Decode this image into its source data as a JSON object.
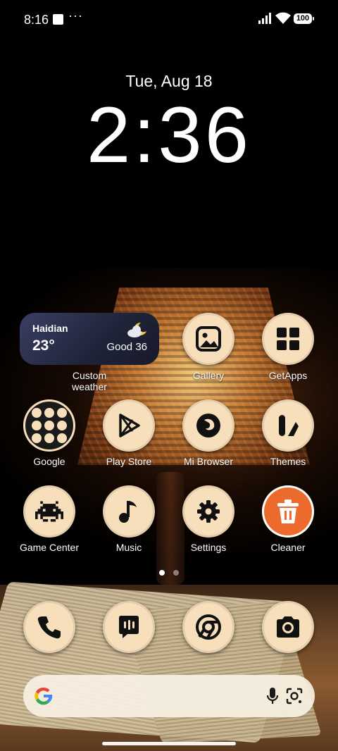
{
  "status_bar": {
    "time": "8:16",
    "overflow": "···",
    "battery": "100"
  },
  "lock": {
    "date": "Tue, Aug 18",
    "time": "2:36"
  },
  "weather_widget": {
    "city": "Haidian",
    "temperature": "23°",
    "condition": "Good 36",
    "label": "Custom weather"
  },
  "apps": {
    "gallery": "Gallery",
    "getapps": "GetApps",
    "google": "Google",
    "play_store": "Play Store",
    "mi_browser": "Mi Browser",
    "themes": "Themes",
    "game_center": "Game Center",
    "music": "Music",
    "settings": "Settings",
    "cleaner": "Cleaner"
  },
  "dock": [
    "phone-icon",
    "messages-icon",
    "chrome-icon",
    "camera-icon"
  ],
  "colors": {
    "icon_bg": "#f8dfbb",
    "icon_fg": "#111111",
    "cleaner_accent": "#ec6a2c"
  }
}
